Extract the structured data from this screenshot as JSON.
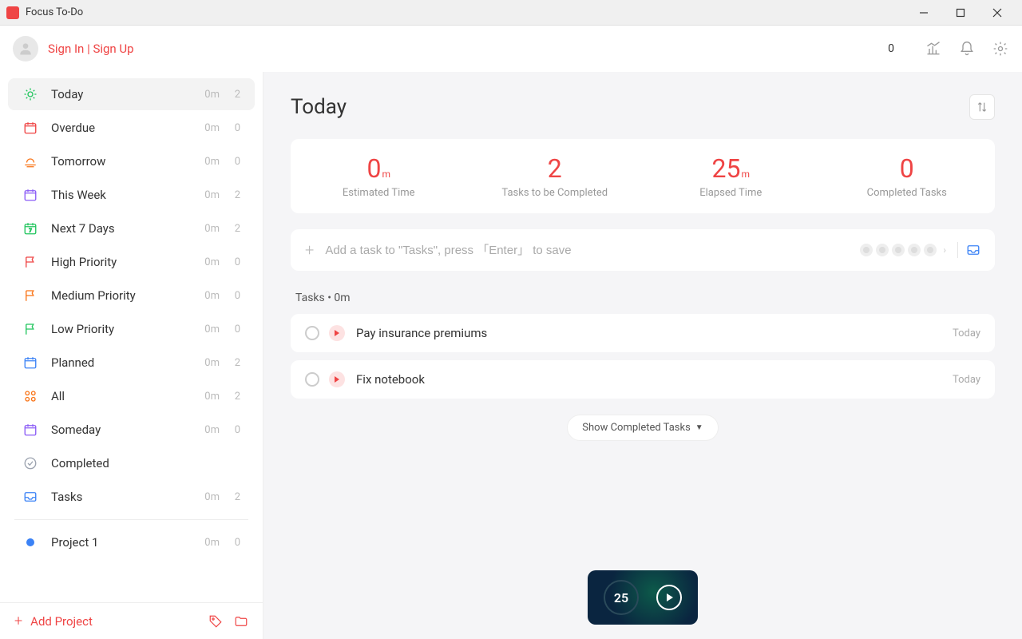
{
  "window": {
    "title": "Focus To-Do"
  },
  "header": {
    "signin": "Sign In | Sign Up",
    "count": "0"
  },
  "sidebar": {
    "items": [
      {
        "label": "Today",
        "meta": "0m",
        "count": "2",
        "icon": "sun",
        "color": "#22c55e",
        "active": true
      },
      {
        "label": "Overdue",
        "meta": "0m",
        "count": "0",
        "icon": "calendar",
        "color": "#ef4444"
      },
      {
        "label": "Tomorrow",
        "meta": "0m",
        "count": "0",
        "icon": "sunset",
        "color": "#f97316"
      },
      {
        "label": "This Week",
        "meta": "0m",
        "count": "2",
        "icon": "calendar",
        "color": "#8b5cf6"
      },
      {
        "label": "Next 7 Days",
        "meta": "0m",
        "count": "2",
        "icon": "calendar7",
        "color": "#22c55e"
      },
      {
        "label": "High Priority",
        "meta": "0m",
        "count": "0",
        "icon": "flag",
        "color": "#ef4444"
      },
      {
        "label": "Medium Priority",
        "meta": "0m",
        "count": "0",
        "icon": "flag",
        "color": "#f97316"
      },
      {
        "label": "Low Priority",
        "meta": "0m",
        "count": "0",
        "icon": "flag",
        "color": "#22c55e"
      },
      {
        "label": "Planned",
        "meta": "0m",
        "count": "2",
        "icon": "calendar",
        "color": "#3b82f6"
      },
      {
        "label": "All",
        "meta": "0m",
        "count": "2",
        "icon": "grid",
        "color": "#f97316"
      },
      {
        "label": "Someday",
        "meta": "0m",
        "count": "0",
        "icon": "calendar",
        "color": "#8b5cf6"
      },
      {
        "label": "Completed",
        "meta": "",
        "count": "",
        "icon": "check",
        "color": "#9ca3af"
      },
      {
        "label": "Tasks",
        "meta": "0m",
        "count": "2",
        "icon": "inbox",
        "color": "#3b82f6"
      }
    ],
    "projects": [
      {
        "label": "Project 1",
        "meta": "0m",
        "count": "0",
        "color": "#3b82f6"
      }
    ],
    "add_project": "Add Project"
  },
  "main": {
    "title": "Today",
    "stats": [
      {
        "value": "0",
        "unit": "m",
        "label": "Estimated Time"
      },
      {
        "value": "2",
        "unit": "",
        "label": "Tasks to be Completed"
      },
      {
        "value": "25",
        "unit": "m",
        "label": "Elapsed Time"
      },
      {
        "value": "0",
        "unit": "",
        "label": "Completed Tasks"
      }
    ],
    "add_task_placeholder": "Add a task to \"Tasks\", press 「Enter」 to save",
    "section_title": "Tasks   •   0m",
    "tasks": [
      {
        "name": "Pay insurance premiums",
        "due": "Today"
      },
      {
        "name": "Fix notebook",
        "due": "Today"
      }
    ],
    "show_completed": "Show Completed Tasks",
    "timer_value": "25"
  }
}
